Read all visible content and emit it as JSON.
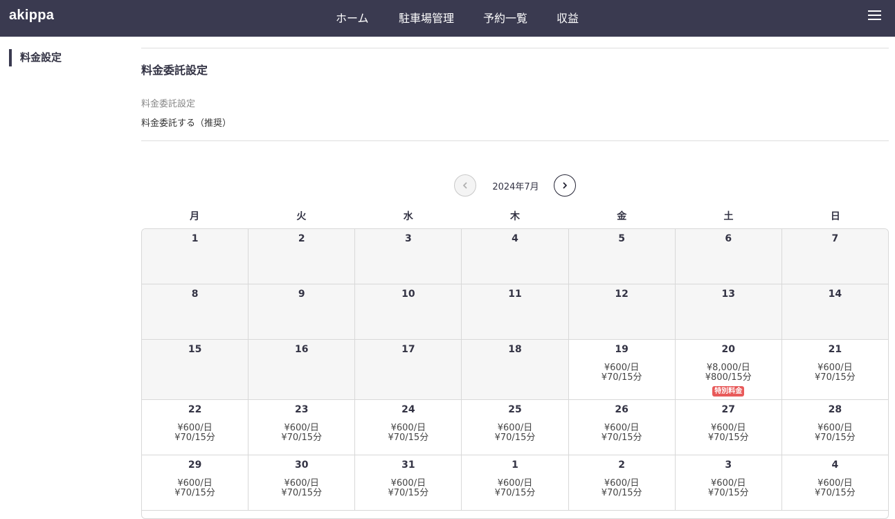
{
  "header": {
    "logo": "akippa",
    "nav": [
      {
        "label": "ホーム"
      },
      {
        "label": "駐車場管理"
      },
      {
        "label": "予約一覧"
      },
      {
        "label": "収益"
      }
    ]
  },
  "sidebar": {
    "items": [
      {
        "label": "料金設定"
      }
    ]
  },
  "main": {
    "section_title": "料金委託設定",
    "field_label": "料金委託設定",
    "field_value": "料金委託する（推奨）"
  },
  "calendar": {
    "month_label": "2024年7月",
    "weekdays": [
      "月",
      "火",
      "水",
      "木",
      "金",
      "土",
      "日"
    ],
    "badge_label": "特別料金",
    "colors": {
      "header_bg": "#3a3a50",
      "past_cell": "#f6f6f6",
      "badge": "#e85a5a"
    },
    "weeks": [
      [
        {
          "day": "1",
          "past": true
        },
        {
          "day": "2",
          "past": true
        },
        {
          "day": "3",
          "past": true
        },
        {
          "day": "4",
          "past": true
        },
        {
          "day": "5",
          "past": true
        },
        {
          "day": "6",
          "past": true
        },
        {
          "day": "7",
          "past": true
        }
      ],
      [
        {
          "day": "8",
          "past": true
        },
        {
          "day": "9",
          "past": true
        },
        {
          "day": "10",
          "past": true
        },
        {
          "day": "11",
          "past": true
        },
        {
          "day": "12",
          "past": true
        },
        {
          "day": "13",
          "past": true
        },
        {
          "day": "14",
          "past": true
        }
      ],
      [
        {
          "day": "15",
          "past": true
        },
        {
          "day": "16",
          "past": true
        },
        {
          "day": "17",
          "past": true
        },
        {
          "day": "18",
          "past": true
        },
        {
          "day": "19",
          "past": false,
          "daily": "¥600/日",
          "per15": "¥70/15分"
        },
        {
          "day": "20",
          "past": false,
          "daily": "¥8,000/日",
          "per15": "¥800/15分",
          "special": true
        },
        {
          "day": "21",
          "past": false,
          "daily": "¥600/日",
          "per15": "¥70/15分"
        }
      ],
      [
        {
          "day": "22",
          "past": false,
          "daily": "¥600/日",
          "per15": "¥70/15分"
        },
        {
          "day": "23",
          "past": false,
          "daily": "¥600/日",
          "per15": "¥70/15分"
        },
        {
          "day": "24",
          "past": false,
          "daily": "¥600/日",
          "per15": "¥70/15分"
        },
        {
          "day": "25",
          "past": false,
          "daily": "¥600/日",
          "per15": "¥70/15分"
        },
        {
          "day": "26",
          "past": false,
          "daily": "¥600/日",
          "per15": "¥70/15分"
        },
        {
          "day": "27",
          "past": false,
          "daily": "¥600/日",
          "per15": "¥70/15分"
        },
        {
          "day": "28",
          "past": false,
          "daily": "¥600/日",
          "per15": "¥70/15分"
        }
      ],
      [
        {
          "day": "29",
          "past": false,
          "daily": "¥600/日",
          "per15": "¥70/15分"
        },
        {
          "day": "30",
          "past": false,
          "daily": "¥600/日",
          "per15": "¥70/15分"
        },
        {
          "day": "31",
          "past": false,
          "daily": "¥600/日",
          "per15": "¥70/15分"
        },
        {
          "day": "1",
          "past": false,
          "daily": "¥600/日",
          "per15": "¥70/15分"
        },
        {
          "day": "2",
          "past": false,
          "daily": "¥600/日",
          "per15": "¥70/15分"
        },
        {
          "day": "3",
          "past": false,
          "daily": "¥600/日",
          "per15": "¥70/15分"
        },
        {
          "day": "4",
          "past": false,
          "daily": "¥600/日",
          "per15": "¥70/15分"
        }
      ]
    ]
  }
}
